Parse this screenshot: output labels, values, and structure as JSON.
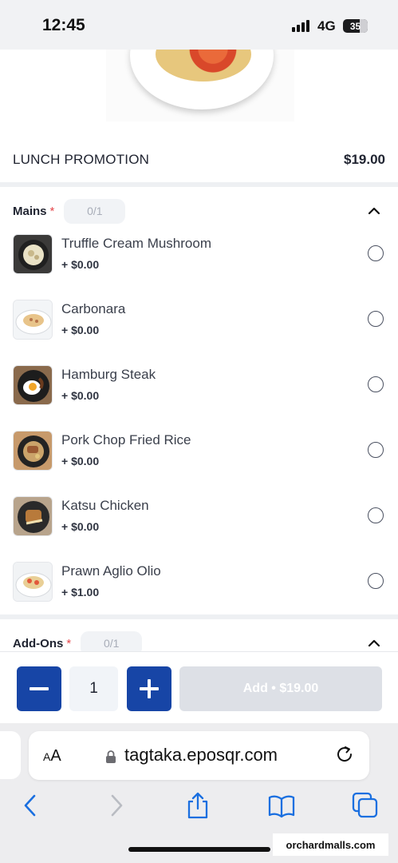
{
  "status_bar": {
    "time": "12:45",
    "network": "4G",
    "battery": "35"
  },
  "product": {
    "title": "LUNCH PROMOTION",
    "price": "$19.00"
  },
  "mains": {
    "title": "Mains",
    "required_mark": "*",
    "count": "0/1",
    "options": [
      {
        "name": "Truffle Cream Mushroom",
        "price": "+ $0.00"
      },
      {
        "name": "Carbonara",
        "price": "+ $0.00"
      },
      {
        "name": "Hamburg Steak",
        "price": "+ $0.00"
      },
      {
        "name": "Pork Chop Fried Rice",
        "price": "+ $0.00"
      },
      {
        "name": "Katsu Chicken",
        "price": "+ $0.00"
      },
      {
        "name": "Prawn Aglio Olio",
        "price": "+ $1.00"
      }
    ]
  },
  "addons": {
    "title": "Add-Ons",
    "required_mark": "*",
    "count": "0/1"
  },
  "cart": {
    "quantity": "1",
    "add_label": "Add • $19.00"
  },
  "browser": {
    "text_size_label_small": "A",
    "text_size_label_large": "A",
    "url": "tagtaka.eposqr.com"
  },
  "watermark": "orchardmalls.com",
  "colors": {
    "accent": "#1745a6",
    "required": "#e5484d",
    "disabled_button": "#dde0e6"
  }
}
